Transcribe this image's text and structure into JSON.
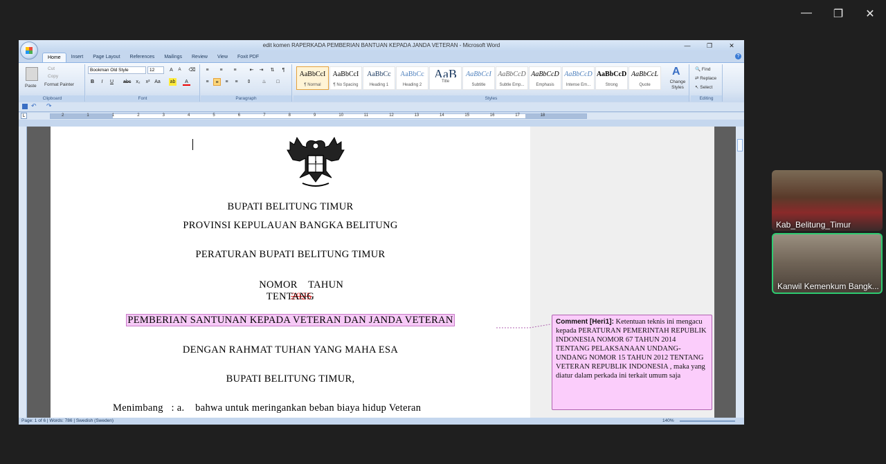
{
  "meeting": {
    "participants": [
      {
        "name": "Kab_Belitung_Timur"
      },
      {
        "name": "Kanwil Kemenkum Bangk..."
      }
    ]
  },
  "word": {
    "title": "edit komen RAPERKADA PEMBERIAN BANTUAN KEPADA JANDA VETERAN - Microsoft Word",
    "tabs": [
      "Home",
      "Insert",
      "Page Layout",
      "References",
      "Mailings",
      "Review",
      "View",
      "Foxit PDF"
    ],
    "clipboard": {
      "paste": "Paste",
      "cut": "Cut",
      "copy": "Copy",
      "format_painter": "Format Painter",
      "label": "Clipboard"
    },
    "font": {
      "name": "Bookman Old Style",
      "size": "12",
      "label": "Font"
    },
    "paragraph_label": "Paragraph",
    "styles_label": "Styles",
    "editing_label": "Editing",
    "styles": [
      {
        "preview": "AaBbCcI",
        "name": "¶ Normal"
      },
      {
        "preview": "AaBbCcI",
        "name": "¶ No Spacing"
      },
      {
        "preview": "AaBbCc",
        "name": "Heading 1"
      },
      {
        "preview": "AaBbCc",
        "name": "Heading 2"
      },
      {
        "preview": "AaB",
        "name": "Title"
      },
      {
        "preview": "AaBbCcI",
        "name": "Subtitle"
      },
      {
        "preview": "AaBbCcD",
        "name": "Subtle Emp..."
      },
      {
        "preview": "AaBbCcD",
        "name": "Emphasis"
      },
      {
        "preview": "AaBbCcD",
        "name": "Intense Em..."
      },
      {
        "preview": "AaBbCcD",
        "name": "Strong"
      },
      {
        "preview": "AaBbCcL",
        "name": "Quote"
      }
    ],
    "change_styles": "Change Styles",
    "editing": {
      "find": "Find",
      "replace": "Replace",
      "select": "Select"
    },
    "ruler_numbers": [
      "2",
      "1",
      "1",
      "2",
      "3",
      "4",
      "5",
      "6",
      "7",
      "8",
      "9",
      "10",
      "11",
      "12",
      "13",
      "14",
      "15",
      "16",
      "17",
      "18"
    ],
    "document": {
      "line1": "BUPATI BELITUNG TIMUR",
      "line2": "PROVINSI KEPULAUAN BANGKA BELITUNG",
      "line3": "PERATURAN BUPATI BELITUNG TIMUR",
      "nomor": "NOMOR    TAHUN",
      "year_deleted": "2025",
      "tentang": "TENTANG",
      "subject": "PEMBERIAN SANTUNAN KEPADA VETERAN DAN JANDA VETERAN",
      "rahmat": "DENGAN RAHMAT TUHAN YANG MAHA ESA",
      "bupati": "BUPATI BELITUNG TIMUR,",
      "menimbang": "Menimbang   : a.    bahwa untuk meringankan beban biaya hidup Veteran"
    },
    "comment": {
      "author": "Comment [Heri1]:",
      "text": "Ketentuan teknis ini mengacu kepada PERATURAN PEMERINTAH REPUBLIK INDONESIA NOMOR 67 TAHUN 2014 TENTANG PELAKSANAAN UNDANG-UNDANG NOMOR 15 TAHUN 2012 TENTANG VETERAN REPUBLIK INDONESIA , maka yang diatur dalam perkada ini terkait umum saja"
    },
    "status": {
      "page": "Page: 1 of 6",
      "words": "Words: 786",
      "language": "Swedish (Sweden)",
      "zoom": "140%"
    }
  }
}
